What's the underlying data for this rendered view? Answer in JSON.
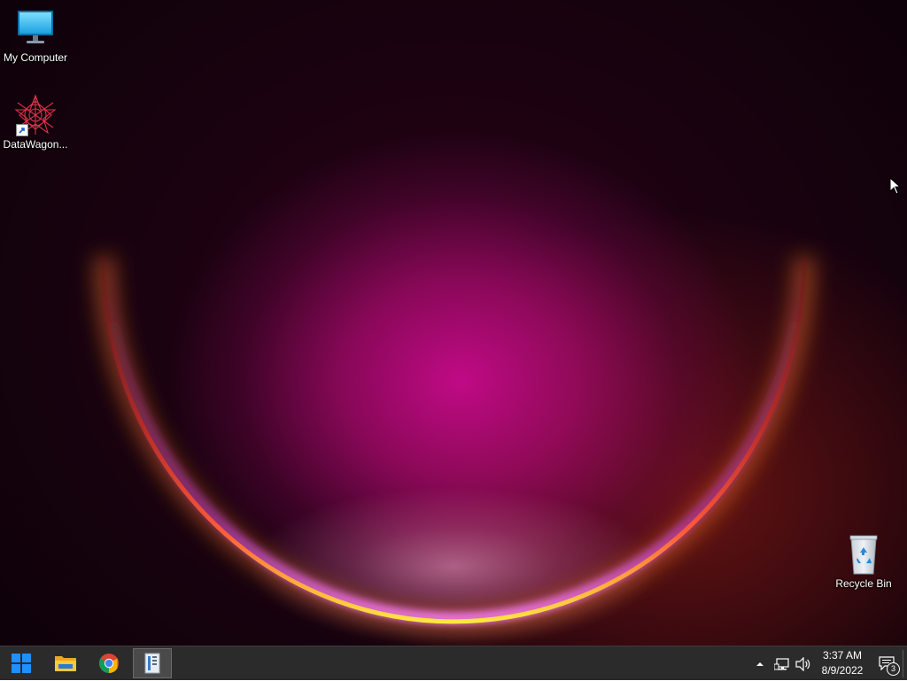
{
  "desktop": {
    "icons": [
      {
        "name": "my-computer",
        "label": "My Computer"
      },
      {
        "name": "datawagon",
        "label": "DataWagon..."
      },
      {
        "name": "recycle-bin",
        "label": "Recycle Bin"
      }
    ]
  },
  "taskbar": {
    "items": [
      {
        "name": "start-button",
        "icon": "windows-logo-icon"
      },
      {
        "name": "file-explorer-button",
        "icon": "folder-icon"
      },
      {
        "name": "chrome-button",
        "icon": "chrome-icon"
      },
      {
        "name": "server-manager-button",
        "icon": "server-icon",
        "active": true
      }
    ],
    "tray": {
      "time": "3:37 AM",
      "date": "8/9/2022",
      "notification_count": "3"
    }
  }
}
